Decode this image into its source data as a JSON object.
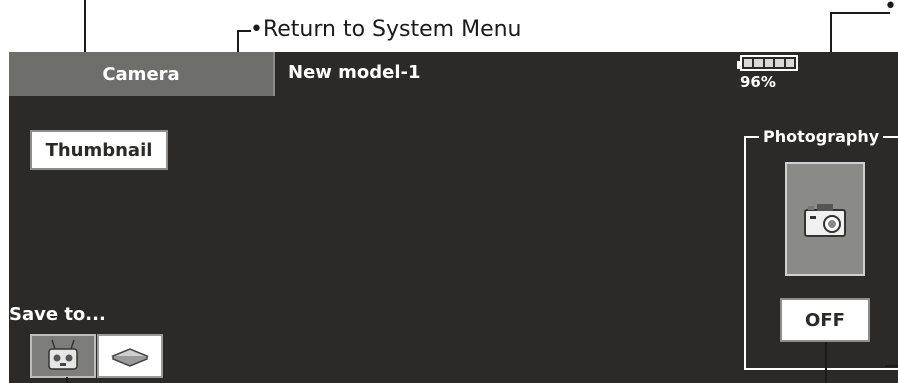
{
  "annotations": {
    "return_label": "•Return to System Menu",
    "top_right_bullet": "•"
  },
  "header": {
    "title": "Camera",
    "model_name": "New model-1",
    "battery_percent": "96%",
    "battery_level": 0.96
  },
  "buttons": {
    "thumbnail": "Thumbnail",
    "off": "OFF"
  },
  "save_to": {
    "label": "Save to...",
    "options": [
      "transmitter",
      "sd-card"
    ],
    "selected": "transmitter"
  },
  "photography": {
    "label": "Photography"
  },
  "icons": {
    "transmitter": "transmitter-icon",
    "card": "sd-card-icon",
    "camera": "camera-icon"
  }
}
